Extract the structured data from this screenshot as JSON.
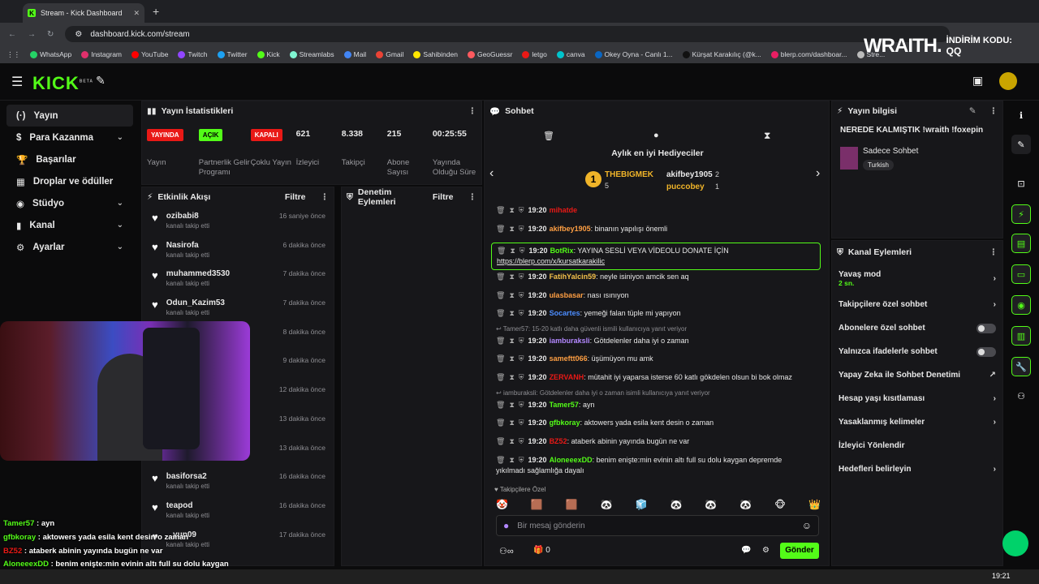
{
  "browser": {
    "tab_title": "Stream - Kick Dashboard",
    "url": "dashboard.kick.com/stream",
    "bookmarks": [
      "WhatsApp",
      "Instagram",
      "YouTube",
      "Twitch",
      "Twitter",
      "Kick",
      "Streamlabs",
      "Mail",
      "Gmail",
      "Sahibinden",
      "GeoGuessr",
      "letgo",
      "canva",
      "Okey Oyna - Canlı 1...",
      "Kürşat Karakılıç (@k...",
      "blerp.com/dashboar...",
      "Stre..."
    ],
    "other_bookmarks": "Tüm Yer İşaretleri"
  },
  "overlay": {
    "brand": "WRAITH.",
    "code_label": "İNDİRİM KODU:",
    "code": "QQ"
  },
  "header": {
    "logo": "KICK",
    "beta": "BETA"
  },
  "sidebar": {
    "items": [
      {
        "label": "Yayın"
      },
      {
        "label": "Para Kazanma"
      },
      {
        "label": "Başarılar"
      },
      {
        "label": "Droplar ve ödüller"
      },
      {
        "label": "Stüdyo"
      },
      {
        "label": "Kanal"
      },
      {
        "label": "Ayarlar"
      }
    ]
  },
  "stats": {
    "title": "Yayın İstatistikleri",
    "items": [
      {
        "value": "YAYINDA",
        "label": "Yayın",
        "color": "#e91916"
      },
      {
        "value": "AÇIK",
        "label": "Partnerlik Gelir Programı",
        "color": "#53fc18"
      },
      {
        "value": "KAPALI",
        "label": "Çoklu Yayın",
        "color": "#e91916"
      },
      {
        "value": "621",
        "label": "İzleyici"
      },
      {
        "value": "8.338",
        "label": "Takipçi"
      },
      {
        "value": "215",
        "label": "Abone Sayısı"
      },
      {
        "value": "00:25:55",
        "label": "Yayında Olduğu Süre"
      }
    ]
  },
  "feed": {
    "title": "Etkinlik Akışı",
    "filter": "Filtre",
    "events": [
      {
        "name": "ozibabi8",
        "sub": "kanalı takip etti",
        "time": "16 saniye önce"
      },
      {
        "name": "Nasirofa",
        "sub": "kanalı takip etti",
        "time": "6 dakika önce"
      },
      {
        "name": "muhammed3530",
        "sub": "kanalı takip etti",
        "time": "7 dakika önce"
      },
      {
        "name": "Odun_Kazim53",
        "sub": "kanalı takip etti",
        "time": "7 dakika önce"
      },
      {
        "name": "",
        "sub": "",
        "time": "8 dakika önce"
      },
      {
        "name": "",
        "sub": "",
        "time": "9 dakika önce"
      },
      {
        "name": "",
        "sub": "",
        "time": "12 dakika önce"
      },
      {
        "name": "",
        "sub": "",
        "time": "13 dakika önce"
      },
      {
        "name": "",
        "sub": "kanalı takip etti",
        "time": "13 dakika önce"
      },
      {
        "name": "basiforsa2",
        "sub": "kanalı takip etti",
        "time": "16 dakika önce"
      },
      {
        "name": "teapod",
        "sub": "kanalı takip etti",
        "time": "16 dakika önce"
      },
      {
        "name": "...yun09",
        "sub": "kanalı takip etti",
        "time": "17 dakika önce"
      }
    ]
  },
  "moderation": {
    "title": "Denetim Eylemleri",
    "filter": "Filtre"
  },
  "chat": {
    "title": "Sohbet",
    "gifters_title": "Aylık en iyi Hediyeciler",
    "gifters": [
      {
        "name": "THEBIGMEK",
        "count": "5"
      },
      {
        "name": "akifbey1905",
        "count": "2"
      },
      {
        "name": "puccobey",
        "count": "1"
      }
    ],
    "messages": [
      {
        "time": "19:20",
        "user": "mihatde",
        "text": "",
        "color": "#e91916"
      },
      {
        "time": "19:20",
        "user": "akifbey1905",
        "text": "binanın yapılışı önemli",
        "color": "#ff9f43"
      },
      {
        "time": "19:20",
        "user": "BotRix",
        "text": "YAYINA SESLİ VEYA VİDEOLU DONATE İÇİN",
        "link": "https://blerp.com/x/kursatkarakilic",
        "color": "#53fc18"
      },
      {
        "time": "19:20",
        "user": "FatihYalcin59",
        "text": "neyle isiniyon amcik sen aq",
        "color": "#f3c14b"
      },
      {
        "time": "19:20",
        "user": "ulasbasar",
        "text": "nası ısınıyon",
        "color": "#ff9f43"
      },
      {
        "time": "19:20",
        "user": "Socartes",
        "text": "yemeği falan tüple mi yapıyon",
        "color": "#4c8dff"
      },
      {
        "reply": "Tamer57: 15-20 katlı daha güvenli ismili kullanıcıya yanıt veriyor"
      },
      {
        "time": "19:20",
        "user": "iamburaksli",
        "text": "Götdelenler daha iyi o zaman",
        "color": "#b388ff"
      },
      {
        "time": "19:20",
        "user": "sameftt066",
        "text": "üşümüyon mu amk",
        "color": "#ff9f43"
      },
      {
        "time": "19:20",
        "user": "ZERVANH",
        "text": "mütahit iyi yaparsa isterse 60 katlı gökdelen olsun bi bok olmaz",
        "color": "#e91916"
      },
      {
        "reply": "iamburaksli: Götdelenler daha iyi o zaman isimli kullanıcıya yanıt veriyor"
      },
      {
        "time": "19:20",
        "user": "Tamer57",
        "text": "ayn",
        "color": "#53fc18"
      },
      {
        "time": "19:20",
        "user": "gfbkoray",
        "text": "aktowers yada esila kent desin o zaman",
        "color": "#53fc18"
      },
      {
        "time": "19:20",
        "user": "BZ52",
        "text": "ataberk abinin yayında bugün ne var",
        "color": "#e91916"
      },
      {
        "time": "19:20",
        "user": "AloneeexDD",
        "text": "benim enişte:min evinin altı full su dolu kaygan depremde yıkılmadı sağlamlığa dayalı",
        "color": "#53fc18"
      }
    ],
    "followers_only": "Takipçilere Özel",
    "input_placeholder": "Bir mesaj gönderin",
    "send": "Gönder",
    "count": "0"
  },
  "info": {
    "title": "Yayın bilgisi",
    "stream_title": "NEREDE KALMIŞTIK !wraith !foxepin",
    "category": "Sadece Sohbet",
    "tag": "Turkish"
  },
  "actions": {
    "title": "Kanal Eylemleri",
    "items": [
      {
        "label": "Yavaş mod",
        "sub": "2 sn."
      },
      {
        "label": "Takipçilere özel sohbet"
      },
      {
        "label": "Abonelere özel sohbet"
      },
      {
        "label": "Yalnızca ifadelerle sohbet"
      },
      {
        "label": "Yapay Zeka ile Sohbet Denetimi"
      },
      {
        "label": "Hesap yaşı kısıtlaması"
      },
      {
        "label": "Yasaklanmış kelimeler"
      },
      {
        "label": "İzleyici Yönlendir"
      },
      {
        "label": "Hedefleri belirleyin"
      }
    ]
  },
  "overlay_chat": [
    {
      "user": "Tamer57",
      "text": "ayn",
      "color": "#53fc18"
    },
    {
      "user": "gfbkoray",
      "text": "aktowers yada esila kent desin o zaman",
      "color": "#53fc18"
    },
    {
      "user": "BZ52",
      "text": "ataberk abinin yayında bugün ne var",
      "color": "#e91916"
    },
    {
      "user": "AloneeexDD",
      "text": "benim enişte:min evinin altı full su dolu kaygan",
      "color": "#53fc18"
    },
    {
      "user": "",
      "text": "depremde yıkılmadı sağlamlığa dayalı",
      "color": "#fff"
    }
  ],
  "taskbar": {
    "time": "19:21"
  }
}
